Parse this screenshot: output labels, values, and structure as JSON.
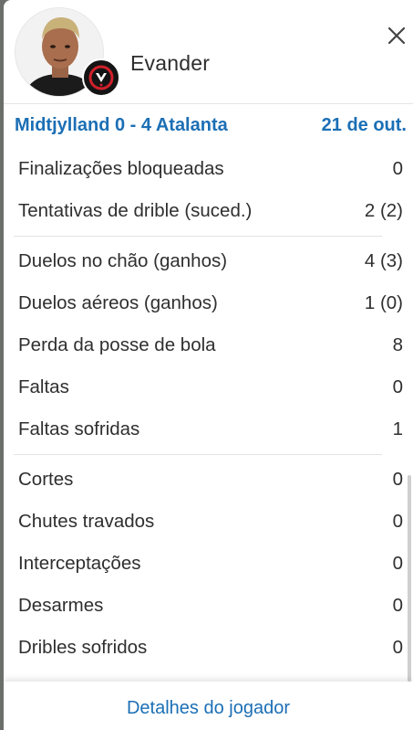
{
  "player": {
    "name": "Evander"
  },
  "match": {
    "score_text": "Midtjylland 0 - 4 Atalanta",
    "date": "21 de out."
  },
  "stats": [
    {
      "label": "Finalizações bloqueadas",
      "value": "0"
    },
    {
      "label": "Tentativas de drible (suced.)",
      "value": "2 (2)"
    },
    {
      "label": "Duelos no chão (ganhos)",
      "value": "4 (3)"
    },
    {
      "label": "Duelos aéreos (ganhos)",
      "value": "1 (0)"
    },
    {
      "label": "Perda da posse de bola",
      "value": "8"
    },
    {
      "label": "Faltas",
      "value": "0"
    },
    {
      "label": "Faltas sofridas",
      "value": "1"
    },
    {
      "label": "Cortes",
      "value": "0"
    },
    {
      "label": "Chutes travados",
      "value": "0"
    },
    {
      "label": "Interceptações",
      "value": "0"
    },
    {
      "label": "Desarmes",
      "value": "0"
    },
    {
      "label": "Dribles sofridos",
      "value": "0"
    }
  ],
  "footer": {
    "details_label": "Detalhes do jogador"
  },
  "icons": {
    "close": "close-icon",
    "team": "midtjylland-crest-icon"
  },
  "colors": {
    "accent": "#1c6fb5",
    "text": "#2f2f2f",
    "divider": "#e3e3e3",
    "team_badge": "#141414",
    "team_red": "#d0202a"
  }
}
